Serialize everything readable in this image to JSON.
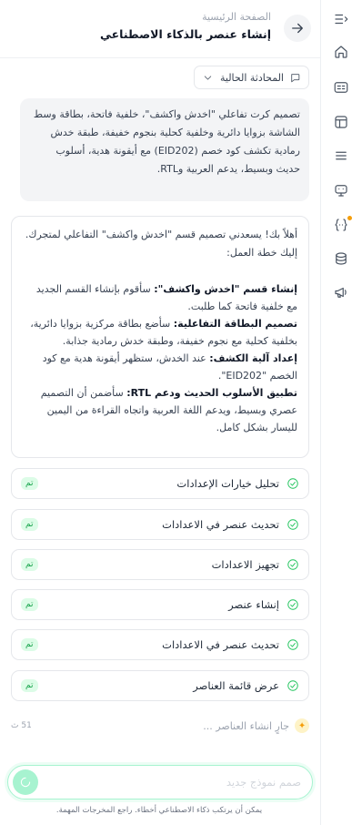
{
  "header": {
    "breadcrumb": "الصفحة الرئيسية",
    "title": "إنشاء عنصر بالذكاء الاصطناعي"
  },
  "conversation_select": {
    "label": "المحادثة الحالية"
  },
  "user_message": {
    "text": "تصميم كرت تفاعلي \"اخدش واكشف\"، خلفية فاتحة، بطاقة وسط الشاشة بزوايا دائرية وخلفية كحلية بنجوم خفيفة، طبقة خدش رمادية تكشف كود خصم (EID202) مع أيقونة هدية، أسلوب حديث وبسيط، يدعم العربية وRTL."
  },
  "ai_message": {
    "intro": "أهلاً بك! يسعدني تصميم قسم \"اخدش واكشف\" التفاعلي لمتجرك. إليك خطة العمل:",
    "sections": [
      {
        "heading": "إنشاء قسم \"اخدش واكشف\":",
        "body": " سأقوم بإنشاء القسم الجديد مع خلفية فاتحة كما طلبت."
      },
      {
        "heading": "تصميم البطاقة التفاعلية:",
        "body": " سأضع بطاقة مركزية بزوايا دائرية، بخلفية كحلية مع نجوم خفيفة، وطبقة خدش رمادية جذابة."
      },
      {
        "heading": "إعداد آلية الكشف:",
        "body": " عند الخدش، ستظهر أيقونة هدية مع كود الخصم \"EID202\"."
      },
      {
        "heading": "تطبيق الأسلوب الحديث ودعم RTL:",
        "body": " سأضمن أن التصميم عصري وبسيط، ويدعم اللغة العربية واتجاه القراءة من اليمين لليسار بشكل كامل."
      }
    ]
  },
  "tasks": [
    {
      "label": "تحليل خيارات الإعدادات",
      "status": "تم"
    },
    {
      "label": "تحديث عنصر في الاعدادات",
      "status": "تم"
    },
    {
      "label": "تجهيز الاعدادات",
      "status": "تم"
    },
    {
      "label": "إنشاء عنصر",
      "status": "تم"
    },
    {
      "label": "تحديث عنصر في الاعدادات",
      "status": "تم"
    },
    {
      "label": "عرض قائمة العناصر",
      "status": "تم"
    }
  ],
  "progress": {
    "text": "جارٍ انشاء العناصر ...",
    "counter": "51 ث"
  },
  "composer": {
    "placeholder": "صمم نموذج جديد"
  },
  "disclaimer": "يمكن أن يرتكب ذكاء الاصطناعي أخطاء. راجع المخرجات المهمة.",
  "colors": {
    "accent": "#22c55e",
    "badge_bg": "#dcfce7",
    "input_border": "#a7f3d0",
    "notification_dot": "#f59e0b"
  },
  "rail_icons": [
    "collapse-menu-icon",
    "home-icon",
    "layout-card-icon",
    "template-icon",
    "list-icon",
    "assistant-icon",
    "code-braces-icon",
    "database-icon",
    "megaphone-icon"
  ]
}
